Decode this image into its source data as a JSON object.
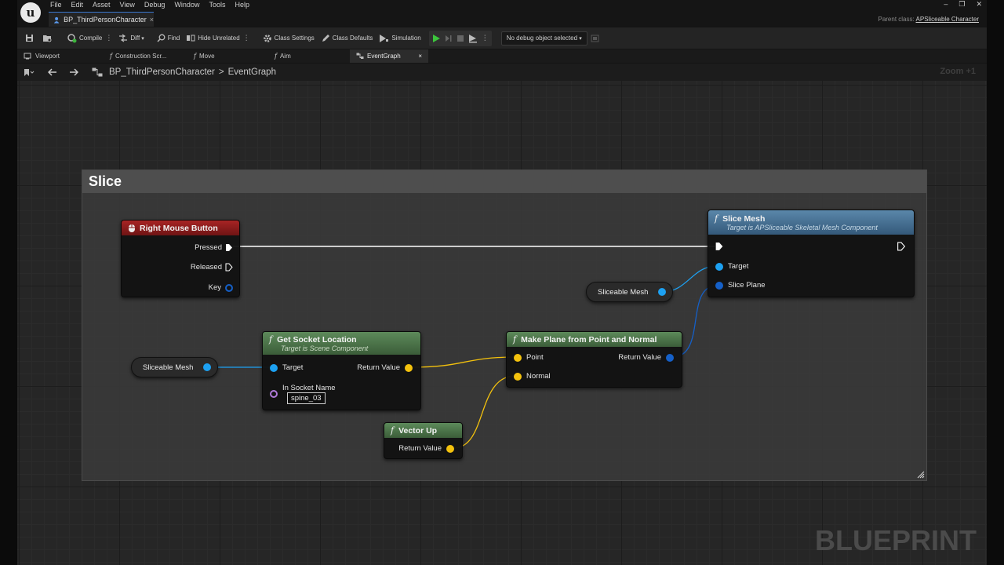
{
  "menu": [
    "File",
    "Edit",
    "Asset",
    "View",
    "Debug",
    "Window",
    "Tools",
    "Help"
  ],
  "asset_tab": "BP_ThirdPersonCharacter",
  "parent_class_label": "Parent class:",
  "parent_class_value": "APSliceable Character",
  "toolbar": {
    "compile": "Compile",
    "diff": "Diff",
    "find": "Find",
    "hide_unrelated": "Hide Unrelated",
    "class_settings": "Class Settings",
    "class_defaults": "Class Defaults",
    "simulation": "Simulation",
    "debug_object": "No debug object selected"
  },
  "doc_tabs": [
    "Viewport",
    "Construction Scr...",
    "Move",
    "Aim",
    "EventGraph"
  ],
  "breadcrumb": {
    "root": "BP_ThirdPersonCharacter",
    "separator": ">",
    "current": "EventGraph"
  },
  "zoom": "Zoom +1",
  "comment_title": "Slice",
  "nodes": {
    "rmb": {
      "title": "Right Mouse Button",
      "pins": [
        "Pressed",
        "Released",
        "Key"
      ]
    },
    "slice_mesh": {
      "title": "Slice Mesh",
      "subtitle": "Target is APSliceable Skeletal Mesh Component",
      "pins": [
        "Target",
        "Slice Plane"
      ]
    },
    "var_top": "Sliceable Mesh",
    "var_left": "Sliceable Mesh",
    "socket": {
      "title": "Get Socket Location",
      "subtitle": "Target is Scene Component",
      "target": "Target",
      "return": "Return Value",
      "socket_name_label": "In Socket Name",
      "socket_name_value": "spine_03"
    },
    "plane": {
      "title": "Make Plane from Point and Normal",
      "point": "Point",
      "normal": "Normal",
      "return": "Return Value"
    },
    "vector_up": {
      "title": "Vector Up",
      "return": "Return Value"
    }
  },
  "colors": {
    "event_header": "#8b1c1c",
    "function_header": "#4e7a4c",
    "target_header": "#3f6a8c",
    "object_pin": "#1da1f2",
    "vector_pin": "#f4c20d",
    "name_pin": "#b07ad8",
    "plane_pin": "#1560c8"
  },
  "watermark": "BLUEPRINT"
}
